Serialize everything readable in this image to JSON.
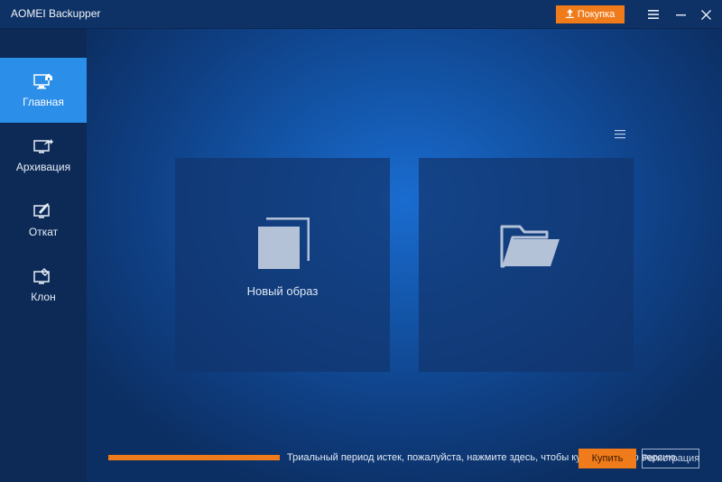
{
  "app": {
    "title": "AOMEI Backupper",
    "buy_label": "Покупка"
  },
  "sidebar": {
    "items": [
      {
        "label": "Главная",
        "icon": "home-monitor-icon",
        "active": true
      },
      {
        "label": "Архивация",
        "icon": "backup-icon",
        "active": false
      },
      {
        "label": "Откат",
        "icon": "restore-icon",
        "active": false
      },
      {
        "label": "Клон",
        "icon": "clone-icon",
        "active": false
      }
    ]
  },
  "main": {
    "tiles": [
      {
        "label": "Новый образ",
        "icon": "new-image-icon"
      },
      {
        "label": "",
        "icon": "folder-open-icon"
      }
    ]
  },
  "footer": {
    "trial_text": "Триальный период истек, пожалуйста, нажмите здесь, чтобы купить полную версию.",
    "purchase_label": "Купить",
    "register_label": "Регистрация"
  },
  "colors": {
    "accent": "#f07b1a",
    "active_nav": "#2b8ee8",
    "titlebar": "#0f3266",
    "sidebar": "#0d2a56"
  }
}
